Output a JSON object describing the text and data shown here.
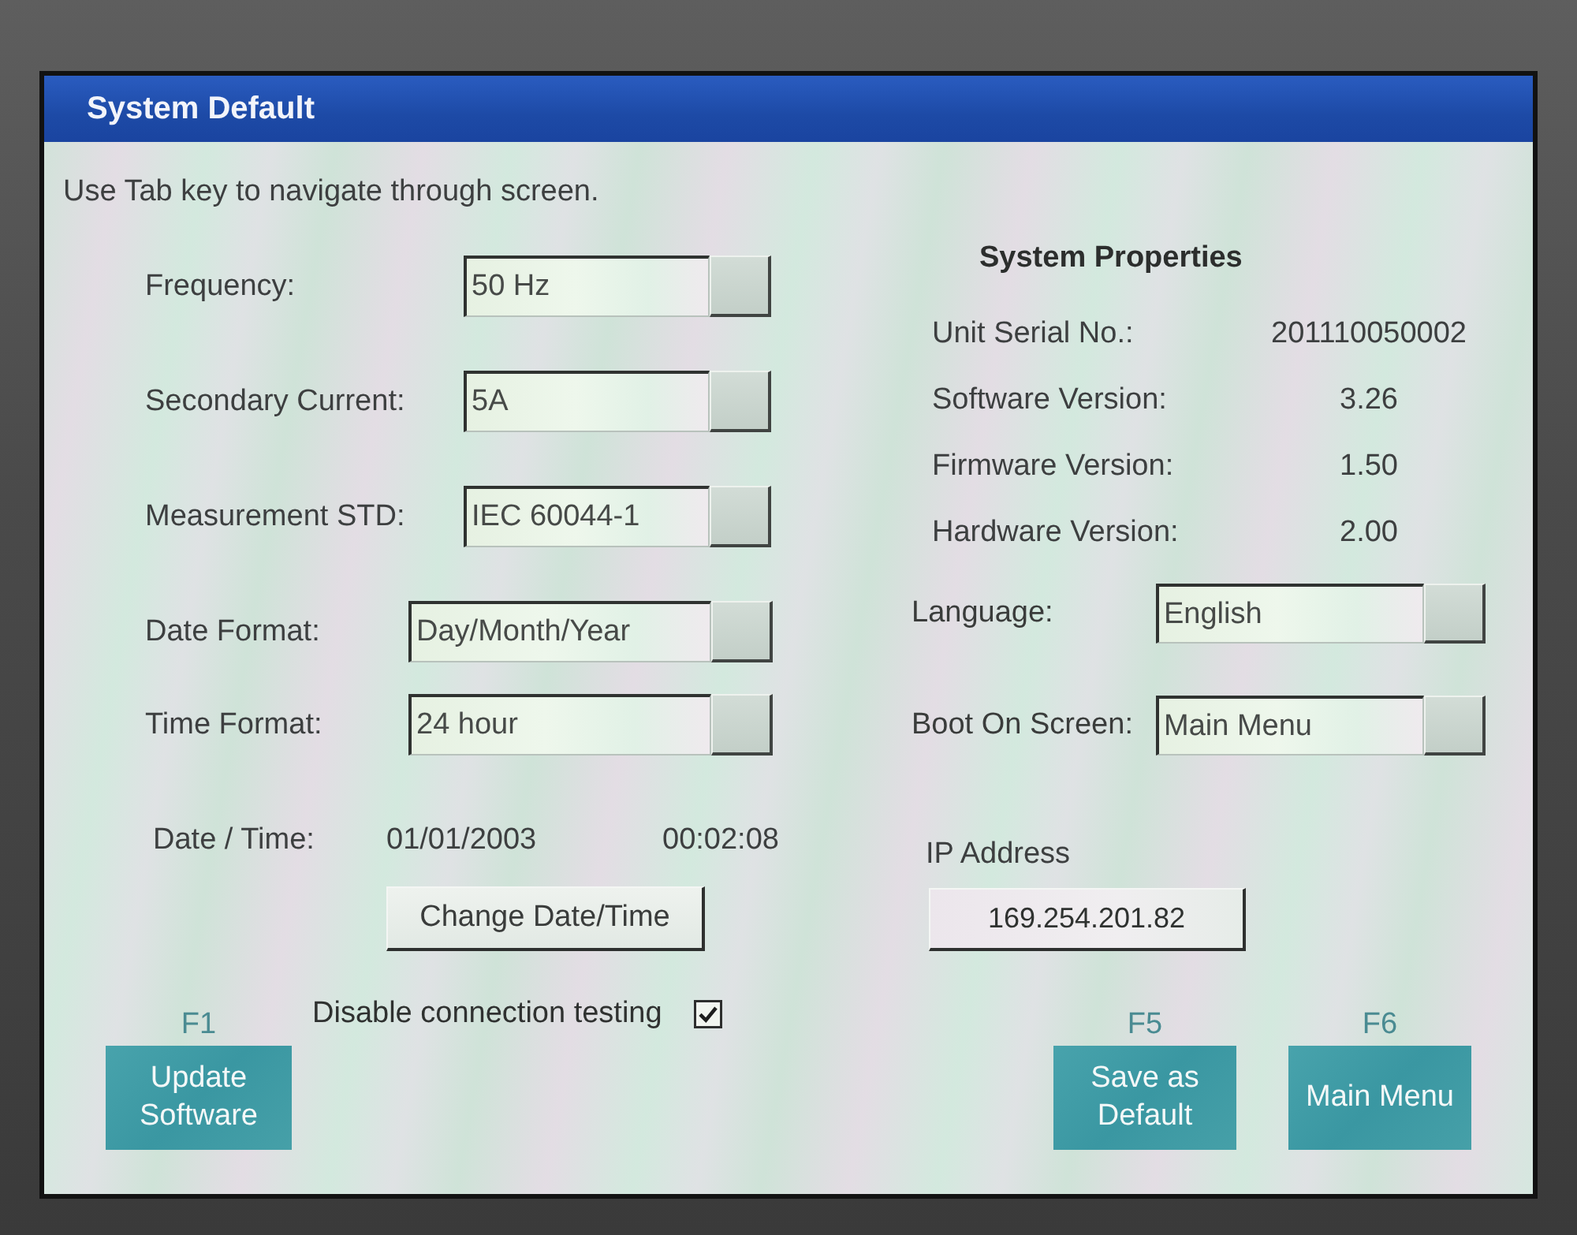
{
  "window": {
    "title": "System Default"
  },
  "hint": "Use Tab key to navigate through screen.",
  "settings": [
    {
      "label": "Frequency:",
      "value": "50 Hz"
    },
    {
      "label": "Secondary Current:",
      "value": "5A"
    },
    {
      "label": "Measurement STD:",
      "value": "IEC 60044-1"
    },
    {
      "label": "Date Format:",
      "value": "Day/Month/Year"
    },
    {
      "label": "Time Format:",
      "value": "24 hour"
    }
  ],
  "date_time": {
    "label": "Date / Time:",
    "date": "01/01/2003",
    "time": "00:02:08",
    "button": "Change Date/Time"
  },
  "connection_testing": {
    "label": "Disable connection testing",
    "checked": true
  },
  "system_properties": {
    "title": "System Properties",
    "rows": [
      {
        "label": "Unit Serial No.:",
        "value": "201110050002"
      },
      {
        "label": "Software Version:",
        "value": "3.26"
      },
      {
        "label": "Firmware Version:",
        "value": "1.50"
      },
      {
        "label": "Hardware Version:",
        "value": "2.00"
      }
    ]
  },
  "preferences": [
    {
      "label": "Language:",
      "value": "English"
    },
    {
      "label": "Boot On Screen:",
      "value": "Main Menu"
    }
  ],
  "ip_address": {
    "label": "IP Address",
    "value": "169.254.201.82"
  },
  "function_keys": [
    {
      "key": "F1",
      "label": "Update Software"
    },
    {
      "key": "F5",
      "label": "Save as Default"
    },
    {
      "key": "F6",
      "label": "Main Menu"
    }
  ]
}
